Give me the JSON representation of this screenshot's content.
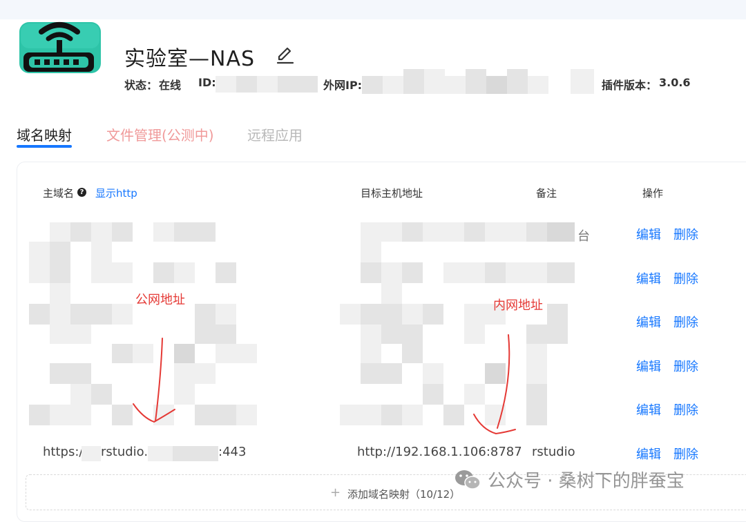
{
  "device": {
    "title": "实验室—NAS",
    "status_label": "状态：",
    "status_value": "在线",
    "id_label": "ID:",
    "ip_label": "外网IP:",
    "plugin_label": "插件版本：",
    "plugin_version": "3.0.6"
  },
  "tabs": {
    "domain_mapping": "域名映射",
    "file_manager": "文件管理(公测中)",
    "remote_apps": "远程应用"
  },
  "table": {
    "col_domain": "主域名",
    "show_http": "显示http",
    "col_target": "目标主机地址",
    "col_note": "备注",
    "col_ops": "操作",
    "edit_label": "编辑",
    "delete_label": "删除",
    "row_note_fragment": "台",
    "last_row": {
      "domain_prefix": "https://",
      "domain_mid": "rstudio.",
      "domain_suffix": ":443",
      "target": "http://192.168.1.106:8787",
      "note": "rstudio"
    }
  },
  "annotations": {
    "public": "公网地址",
    "internal": "内网地址"
  },
  "add_mapping": {
    "label": "添加域名映射（10/12）"
  },
  "watermark": {
    "text": "公众号 · 桑树下的胖蚕宝"
  },
  "colors": {
    "accent": "#1677ff",
    "annotation": "#e53935"
  }
}
